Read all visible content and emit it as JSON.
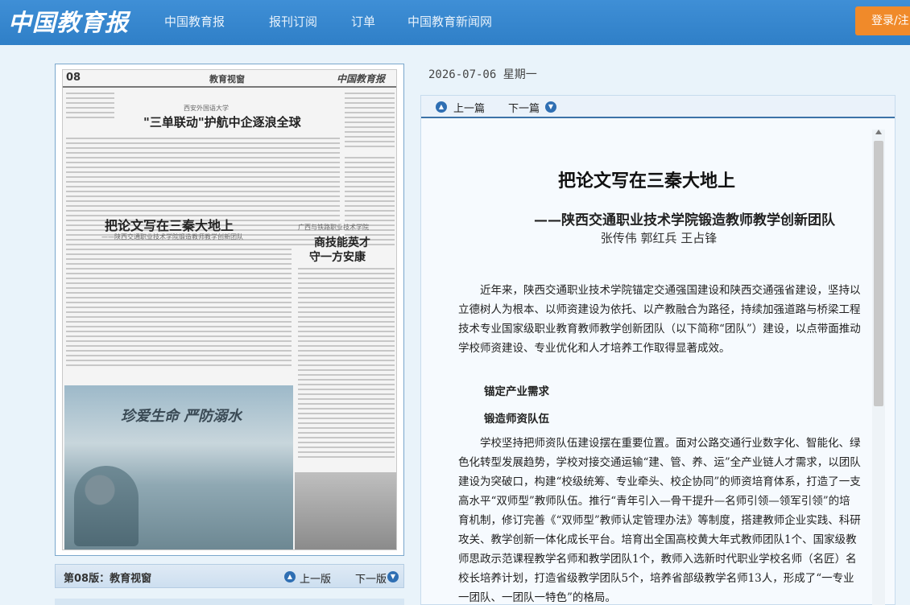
{
  "header": {
    "logo": "中国教育报",
    "nav": [
      "中国教育报",
      "报刊订阅",
      "订单",
      "中国教育新闻网"
    ],
    "login_label": "登录/注"
  },
  "page_preview": {
    "page_number": "08",
    "section_name": "教育视窗",
    "paper_logo": "中国教育报",
    "headline_1": "\"三单联动\"护航中企逐浪全球",
    "headline_1_kicker": "西安外国语大学",
    "headline_2": "把论文写在三秦大地上",
    "headline_2_sub": "——陕西交通职业技术学院锻造教师教学创新团队",
    "headline_3_kicker": "广西与铁路职业技术学院",
    "headline_3a": "商技能英才",
    "headline_3b": "守一方安康",
    "photo_title": "珍爱生命 严防溺水"
  },
  "page_nav": {
    "label": "第08版：教育视窗",
    "prev": "上一版",
    "next": "下一版"
  },
  "date": "2026-07-06 星期一",
  "article_nav": {
    "prev": "上一篇",
    "next": "下一篇"
  },
  "article": {
    "title": "把论文写在三秦大地上",
    "subtitle": "——陕西交通职业技术学院锻造教师教学创新团队",
    "authors": "张传伟 郭红兵 王占锋",
    "para1": "近年来，陕西交通职业技术学院锚定交通强国建设和陕西交通强省建设，坚持以立德树人为根本、以师资建设为依托、以产教融合为路径，持续加强道路与桥梁工程技术专业国家级职业教育教师教学创新团队（以下简称“团队”）建设，以点带面推动学校师资建设、专业优化和人才培养工作取得显著成效。",
    "heading1": "锚定产业需求",
    "heading2": "锻造师资队伍",
    "para2": "学校坚持把师资队伍建设摆在重要位置。面对公路交通行业数字化、智能化、绿色化转型发展趋势，学校对接交通运输“建、管、养、运”全产业链人才需求，以团队建设为突破口，构建“校级统筹、专业牵头、校企协同”的师资培育体系，打造了一支高水平“双师型”教师队伍。推行“青年引入—骨干提升—名师引领—领军引领”的培育机制，修订完善《“双师型”教师认定管理办法》等制度，搭建教师企业实践、科研攻关、教学创新一体化成长平台。培育出全国高校黄大年式教师团队1个、国家级教师思政示范课程教学名师和教学团队1个，教师入选新时代职业学校名师（名匠）名校长培养计划，打造省级教学团队5个，培养省部级教学名师13人，形成了“一专业一团队、一团队一特色”的格局。"
  }
}
